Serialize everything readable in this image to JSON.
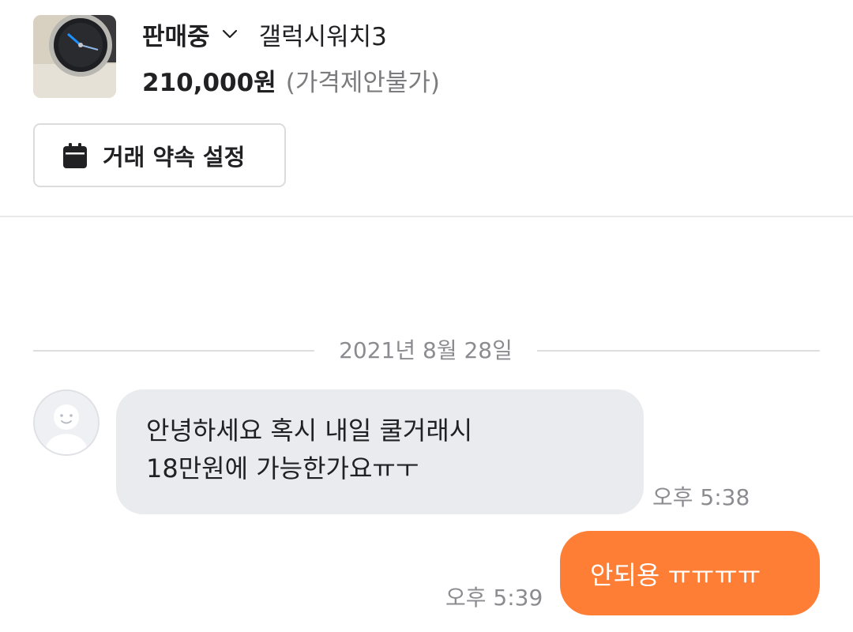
{
  "product": {
    "status": "판매중",
    "title": "갤럭시워치3",
    "price": "210,000원",
    "price_note": "(가격제안불가)",
    "appointment_button_label": "거래 약속 설정"
  },
  "icons": {
    "status_dropdown": "chevron-down-icon",
    "appointment": "calendar-icon",
    "avatar": "default-profile-avatar"
  },
  "colors": {
    "accent": "#ff7e36",
    "incoming_bubble": "#eaebee",
    "muted_text": "#8b8b90"
  },
  "chat": {
    "date": "2021년 8월 28일",
    "messages": [
      {
        "direction": "incoming",
        "lines": [
          "안녕하세요 혹시 내일 쿨거래시",
          "18만원에 가능한가요ㅠㅜ"
        ],
        "time": "오후 5:38"
      },
      {
        "direction": "outgoing",
        "text": "안되용 ㅠㅠㅠㅠ",
        "time": "오후 5:39"
      }
    ]
  }
}
